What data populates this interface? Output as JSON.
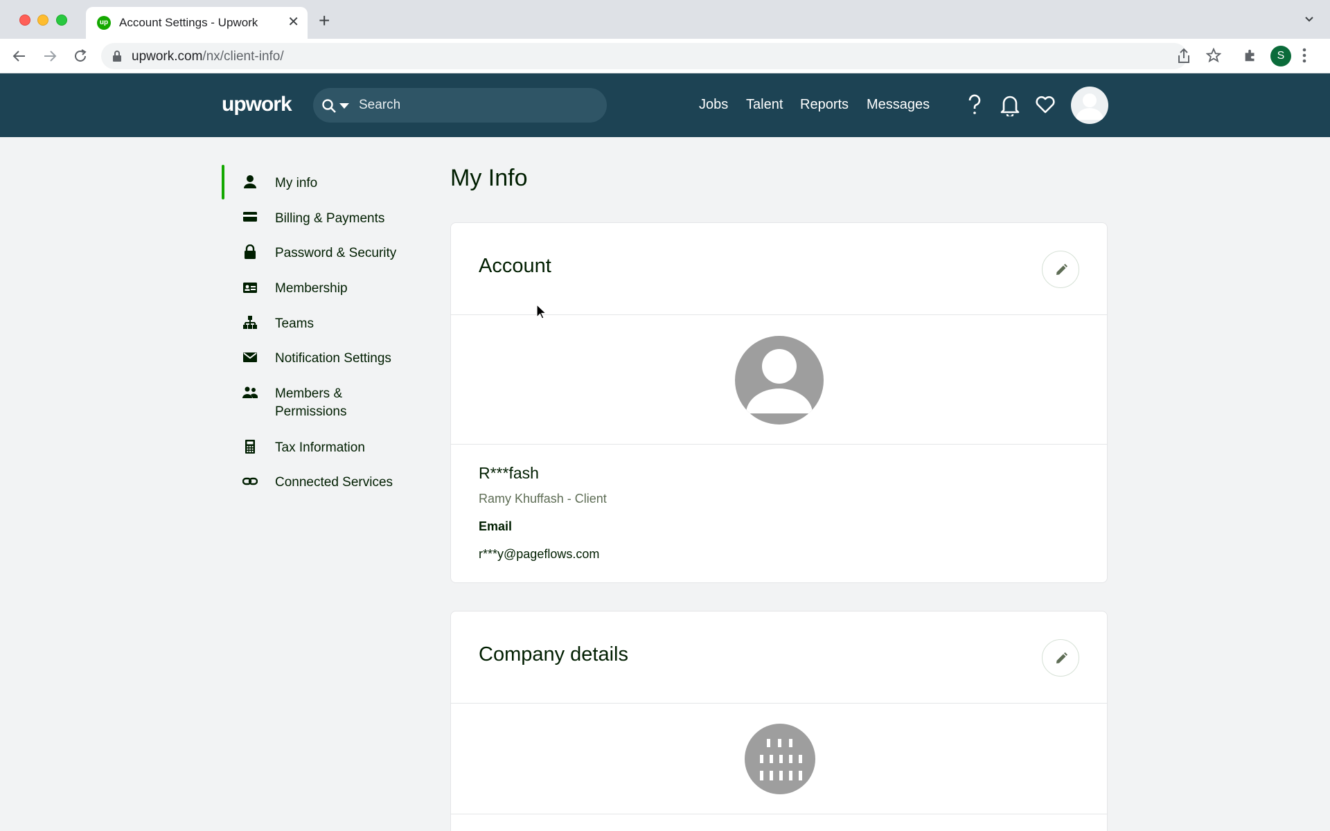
{
  "browser": {
    "tab_title": "Account Settings - Upwork",
    "tab_favicon": "up",
    "url_domain": "upwork.com",
    "url_path": "/nx/client-info/",
    "profile_initial": "S",
    "icons": [
      "back-icon",
      "forward-icon",
      "reload-icon",
      "lock-icon",
      "share-icon",
      "star-icon",
      "extensions-icon",
      "menu-icon"
    ]
  },
  "header": {
    "logo": "upwork",
    "search_placeholder": "Search",
    "nav": [
      "Jobs",
      "Talent",
      "Reports",
      "Messages"
    ],
    "icons": [
      "help-icon",
      "bell-icon",
      "heart-icon"
    ],
    "bg_color": "#1d4354"
  },
  "sidebar": {
    "accent_color": "#14a800",
    "items": [
      {
        "label": "My info",
        "icon": "person-icon",
        "active": true
      },
      {
        "label": "Billing & Payments",
        "icon": "card-icon"
      },
      {
        "label": "Password & Security",
        "icon": "lock-icon"
      },
      {
        "label": "Membership",
        "icon": "id-card-icon"
      },
      {
        "label": "Teams",
        "icon": "org-chart-icon"
      },
      {
        "label": "Notification Settings",
        "icon": "envelope-icon"
      },
      {
        "label": "Members & Permissions",
        "icon": "people-icon"
      },
      {
        "label": "Tax Information",
        "icon": "calculator-icon"
      },
      {
        "label": "Connected Services",
        "icon": "link-icon"
      }
    ]
  },
  "main": {
    "page_title": "My Info",
    "account": {
      "title": "Account",
      "name": "R***fash",
      "subtitle": "Ramy Khuffash - Client",
      "email_label": "Email",
      "email_value": "r***y@pageflows.com"
    },
    "company": {
      "title": "Company details"
    }
  }
}
